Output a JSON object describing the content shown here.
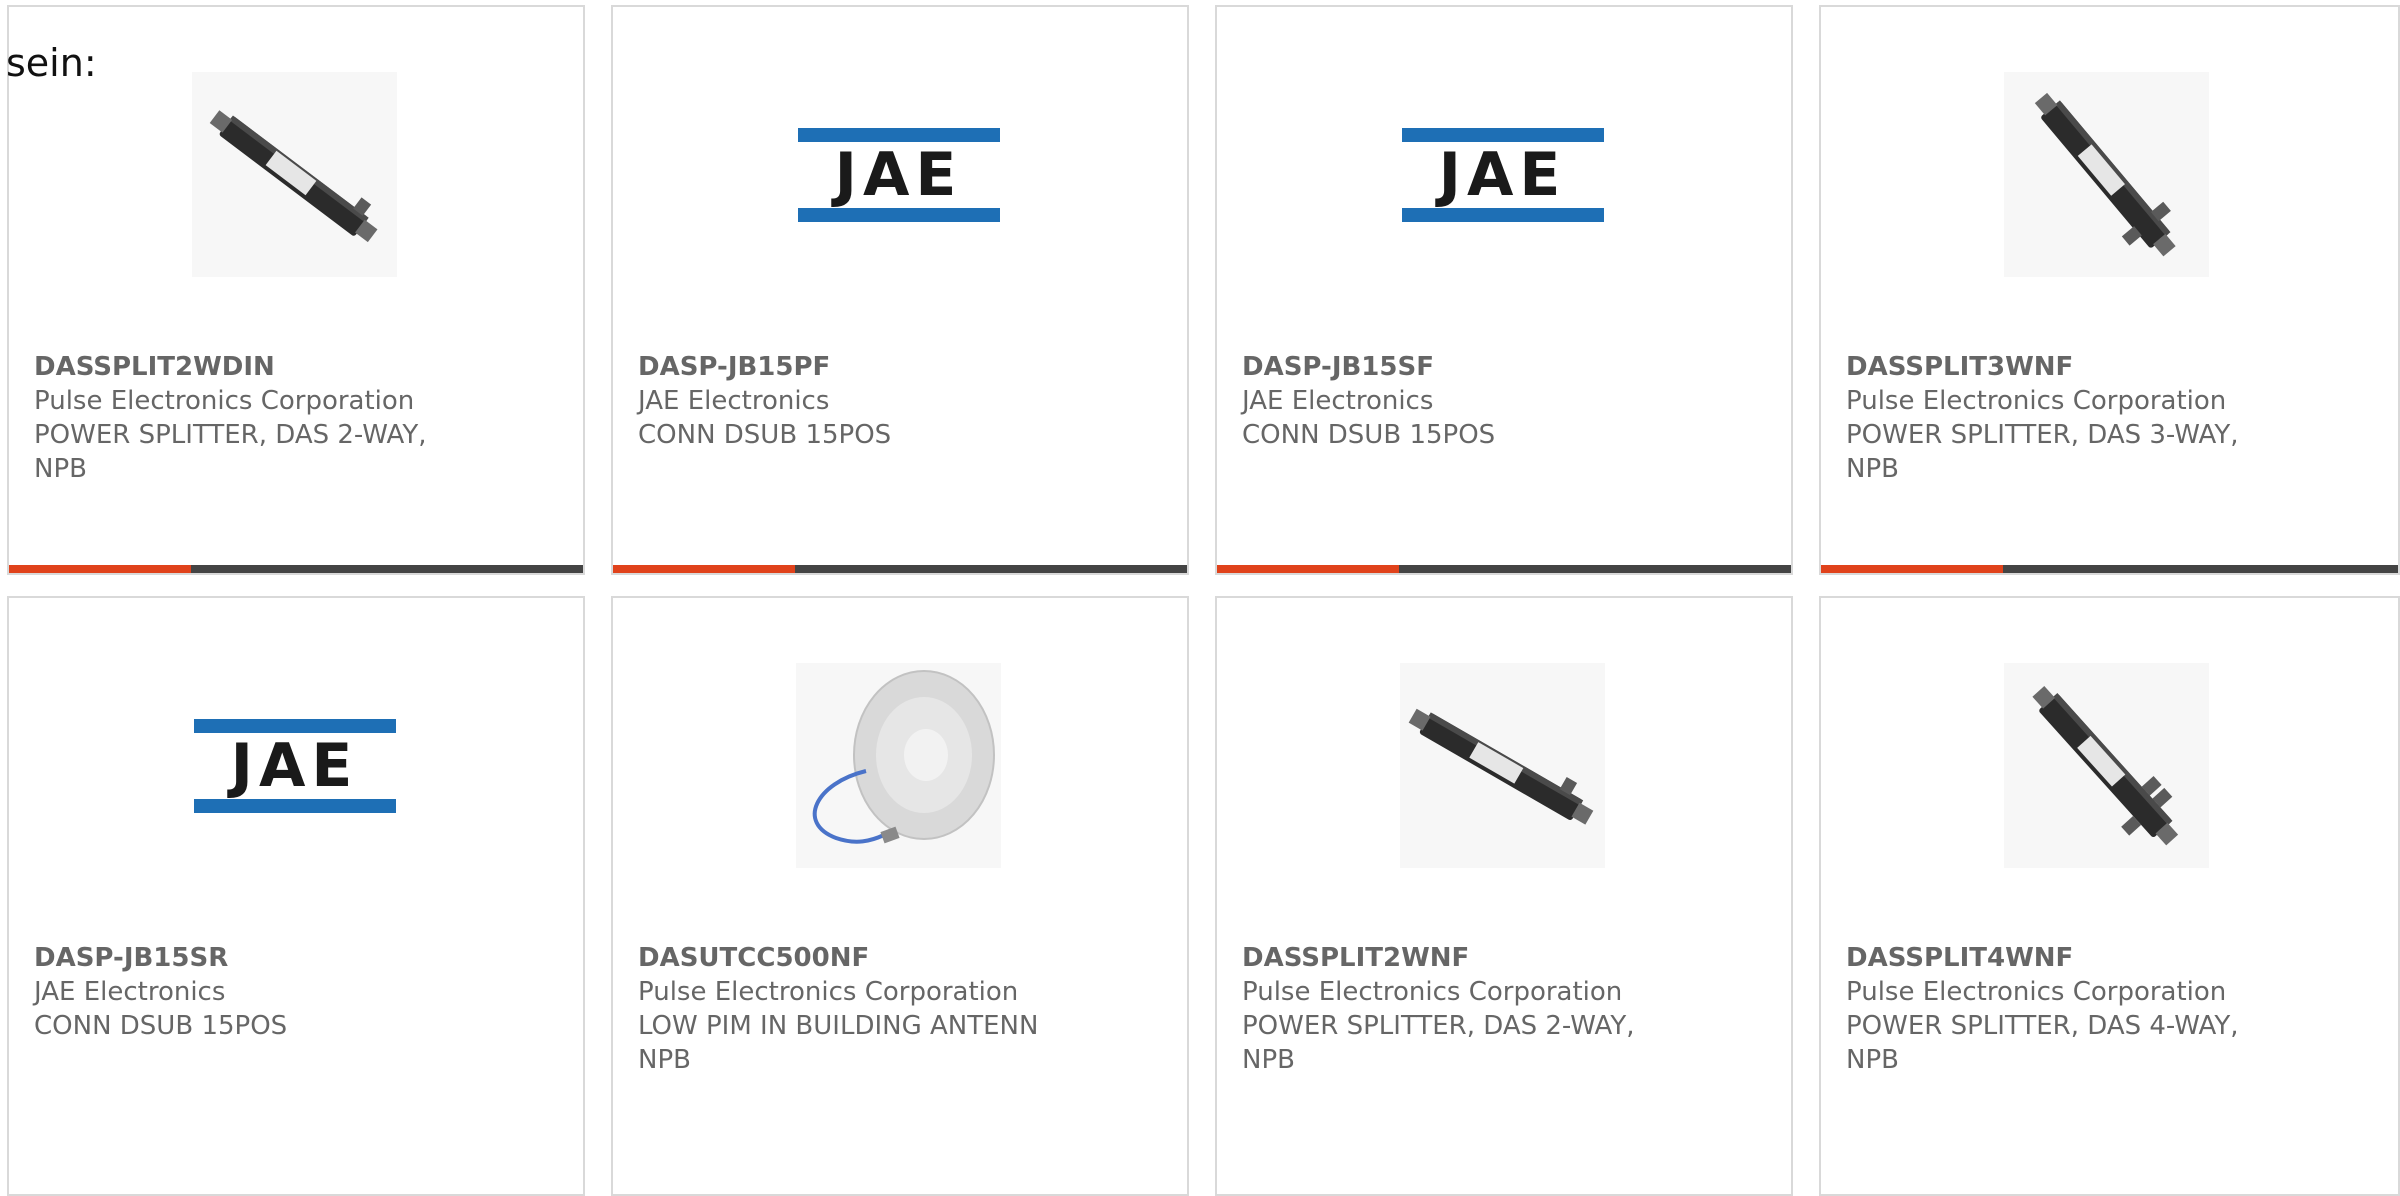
{
  "intro_text": "sein:",
  "products": [
    {
      "part": "DASSPLIT2WDIN",
      "manufacturer": "Pulse Electronics Corporation",
      "desc1": "POWER SPLITTER, DAS 2-WAY,",
      "desc2": "NPB",
      "image": "splitter-2way-photo"
    },
    {
      "part": "DASP-JB15PF",
      "manufacturer": "JAE Electronics",
      "desc1": "CONN DSUB 15POS",
      "desc2": "",
      "image": "jae-logo",
      "logo_text": "JAE"
    },
    {
      "part": "DASP-JB15SF",
      "manufacturer": "JAE Electronics",
      "desc1": "CONN DSUB 15POS",
      "desc2": "",
      "image": "jae-logo",
      "logo_text": "JAE"
    },
    {
      "part": "DASSPLIT3WNF",
      "manufacturer": "Pulse Electronics Corporation",
      "desc1": "POWER SPLITTER, DAS 3-WAY,",
      "desc2": "NPB",
      "image": "splitter-3way-photo"
    },
    {
      "part": "DASP-JB15SR",
      "manufacturer": "JAE Electronics",
      "desc1": "CONN DSUB 15POS",
      "desc2": "",
      "image": "jae-logo",
      "logo_text": "JAE"
    },
    {
      "part": "DASUTCC500NF",
      "manufacturer": "Pulse Electronics Corporation",
      "desc1": "LOW PIM IN BUILDING ANTENN",
      "desc2": "NPB",
      "image": "ceiling-antenna-photo"
    },
    {
      "part": "DASSPLIT2WNF",
      "manufacturer": "Pulse Electronics Corporation",
      "desc1": "POWER SPLITTER, DAS 2-WAY,",
      "desc2": "NPB",
      "image": "splitter-2way-photo"
    },
    {
      "part": "DASSPLIT4WNF",
      "manufacturer": "Pulse Electronics Corporation",
      "desc1": "POWER SPLITTER, DAS 4-WAY,",
      "desc2": "NPB",
      "image": "splitter-4way-photo"
    }
  ],
  "colors": {
    "accent": "#e0421b",
    "bar": "#444444",
    "jae_blue": "#1e6fb5",
    "card_border": "#d9d9d9",
    "text": "#666666"
  }
}
